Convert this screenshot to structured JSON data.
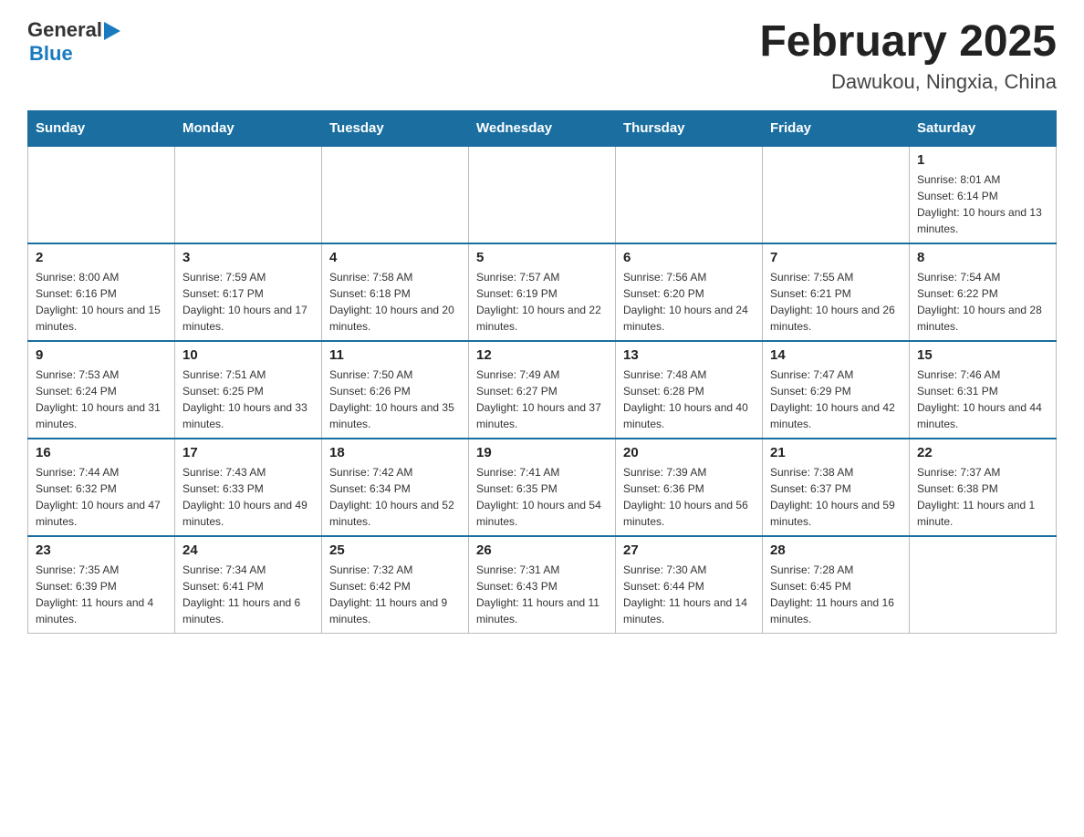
{
  "header": {
    "title": "February 2025",
    "subtitle": "Dawukou, Ningxia, China",
    "logo": {
      "general": "General",
      "blue": "Blue"
    }
  },
  "days_of_week": [
    "Sunday",
    "Monday",
    "Tuesday",
    "Wednesday",
    "Thursday",
    "Friday",
    "Saturday"
  ],
  "weeks": [
    [
      {
        "day": "",
        "info": ""
      },
      {
        "day": "",
        "info": ""
      },
      {
        "day": "",
        "info": ""
      },
      {
        "day": "",
        "info": ""
      },
      {
        "day": "",
        "info": ""
      },
      {
        "day": "",
        "info": ""
      },
      {
        "day": "1",
        "info": "Sunrise: 8:01 AM\nSunset: 6:14 PM\nDaylight: 10 hours and 13 minutes."
      }
    ],
    [
      {
        "day": "2",
        "info": "Sunrise: 8:00 AM\nSunset: 6:16 PM\nDaylight: 10 hours and 15 minutes."
      },
      {
        "day": "3",
        "info": "Sunrise: 7:59 AM\nSunset: 6:17 PM\nDaylight: 10 hours and 17 minutes."
      },
      {
        "day": "4",
        "info": "Sunrise: 7:58 AM\nSunset: 6:18 PM\nDaylight: 10 hours and 20 minutes."
      },
      {
        "day": "5",
        "info": "Sunrise: 7:57 AM\nSunset: 6:19 PM\nDaylight: 10 hours and 22 minutes."
      },
      {
        "day": "6",
        "info": "Sunrise: 7:56 AM\nSunset: 6:20 PM\nDaylight: 10 hours and 24 minutes."
      },
      {
        "day": "7",
        "info": "Sunrise: 7:55 AM\nSunset: 6:21 PM\nDaylight: 10 hours and 26 minutes."
      },
      {
        "day": "8",
        "info": "Sunrise: 7:54 AM\nSunset: 6:22 PM\nDaylight: 10 hours and 28 minutes."
      }
    ],
    [
      {
        "day": "9",
        "info": "Sunrise: 7:53 AM\nSunset: 6:24 PM\nDaylight: 10 hours and 31 minutes."
      },
      {
        "day": "10",
        "info": "Sunrise: 7:51 AM\nSunset: 6:25 PM\nDaylight: 10 hours and 33 minutes."
      },
      {
        "day": "11",
        "info": "Sunrise: 7:50 AM\nSunset: 6:26 PM\nDaylight: 10 hours and 35 minutes."
      },
      {
        "day": "12",
        "info": "Sunrise: 7:49 AM\nSunset: 6:27 PM\nDaylight: 10 hours and 37 minutes."
      },
      {
        "day": "13",
        "info": "Sunrise: 7:48 AM\nSunset: 6:28 PM\nDaylight: 10 hours and 40 minutes."
      },
      {
        "day": "14",
        "info": "Sunrise: 7:47 AM\nSunset: 6:29 PM\nDaylight: 10 hours and 42 minutes."
      },
      {
        "day": "15",
        "info": "Sunrise: 7:46 AM\nSunset: 6:31 PM\nDaylight: 10 hours and 44 minutes."
      }
    ],
    [
      {
        "day": "16",
        "info": "Sunrise: 7:44 AM\nSunset: 6:32 PM\nDaylight: 10 hours and 47 minutes."
      },
      {
        "day": "17",
        "info": "Sunrise: 7:43 AM\nSunset: 6:33 PM\nDaylight: 10 hours and 49 minutes."
      },
      {
        "day": "18",
        "info": "Sunrise: 7:42 AM\nSunset: 6:34 PM\nDaylight: 10 hours and 52 minutes."
      },
      {
        "day": "19",
        "info": "Sunrise: 7:41 AM\nSunset: 6:35 PM\nDaylight: 10 hours and 54 minutes."
      },
      {
        "day": "20",
        "info": "Sunrise: 7:39 AM\nSunset: 6:36 PM\nDaylight: 10 hours and 56 minutes."
      },
      {
        "day": "21",
        "info": "Sunrise: 7:38 AM\nSunset: 6:37 PM\nDaylight: 10 hours and 59 minutes."
      },
      {
        "day": "22",
        "info": "Sunrise: 7:37 AM\nSunset: 6:38 PM\nDaylight: 11 hours and 1 minute."
      }
    ],
    [
      {
        "day": "23",
        "info": "Sunrise: 7:35 AM\nSunset: 6:39 PM\nDaylight: 11 hours and 4 minutes."
      },
      {
        "day": "24",
        "info": "Sunrise: 7:34 AM\nSunset: 6:41 PM\nDaylight: 11 hours and 6 minutes."
      },
      {
        "day": "25",
        "info": "Sunrise: 7:32 AM\nSunset: 6:42 PM\nDaylight: 11 hours and 9 minutes."
      },
      {
        "day": "26",
        "info": "Sunrise: 7:31 AM\nSunset: 6:43 PM\nDaylight: 11 hours and 11 minutes."
      },
      {
        "day": "27",
        "info": "Sunrise: 7:30 AM\nSunset: 6:44 PM\nDaylight: 11 hours and 14 minutes."
      },
      {
        "day": "28",
        "info": "Sunrise: 7:28 AM\nSunset: 6:45 PM\nDaylight: 11 hours and 16 minutes."
      },
      {
        "day": "",
        "info": ""
      }
    ]
  ]
}
